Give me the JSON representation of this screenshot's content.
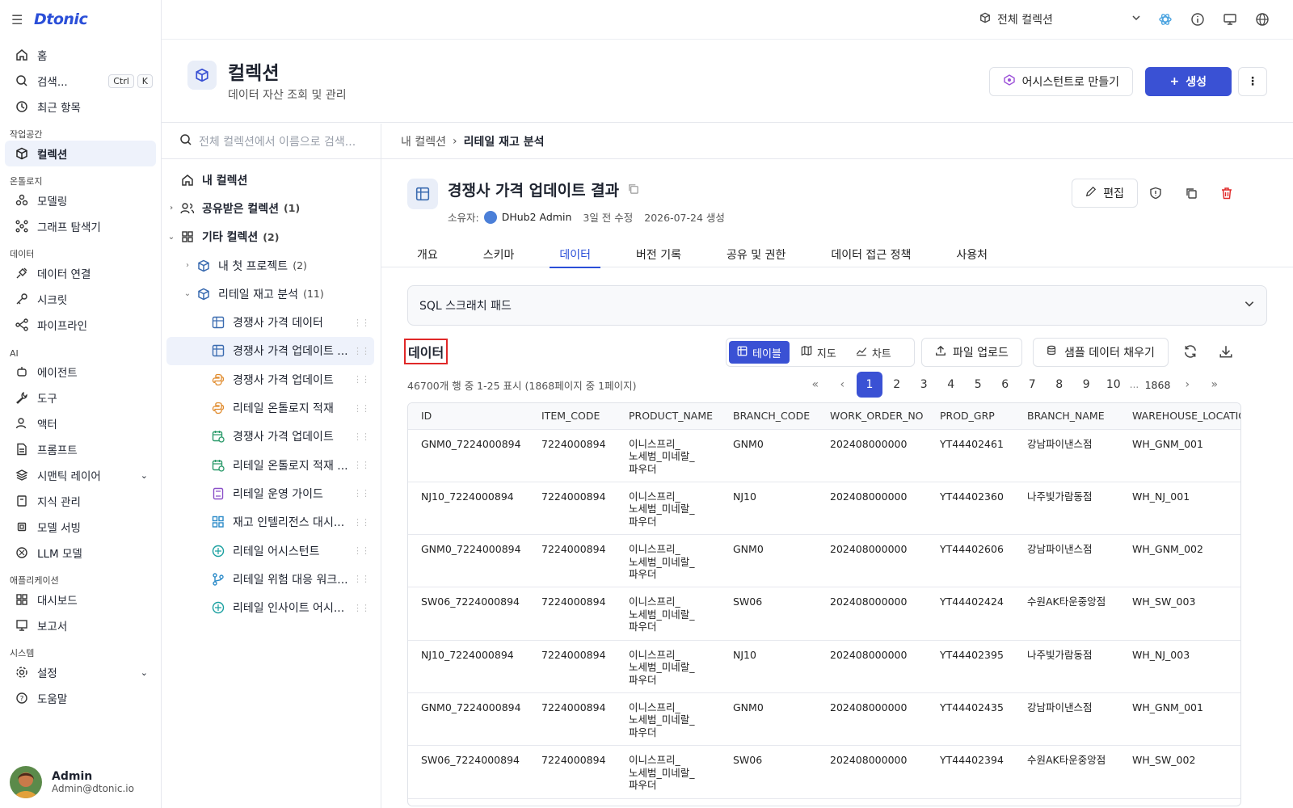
{
  "brand": {
    "name": "Dtonic"
  },
  "nav": {
    "home": "홈",
    "search": "검색...",
    "search_kbd": [
      "Ctrl",
      "K"
    ],
    "recent": "최근 항목",
    "sections": {
      "workspace": "작업공간",
      "ontology": "온톨로지",
      "data": "데이터",
      "ai": "AI",
      "apps": "애플리케이션",
      "system": "시스템"
    },
    "collection": "컬렉션",
    "modeling": "모델링",
    "graph": "그래프 탐색기",
    "connect": "데이터 연결",
    "secret": "시크릿",
    "pipeline": "파이프라인",
    "agent": "에이전트",
    "tool": "도구",
    "actor": "액터",
    "prompt": "프롬프트",
    "semantic": "시맨틱 레이어",
    "knowledge": "지식 관리",
    "serving": "모델 서빙",
    "llm": "LLM 모델",
    "dashboard": "대시보드",
    "report": "보고서",
    "settings": "설정",
    "help": "도움말"
  },
  "user": {
    "name": "Admin",
    "email": "Admin@dtonic.io"
  },
  "topbar": {
    "collection_select": "전체 컬렉션"
  },
  "header": {
    "title": "컬렉션",
    "subtitle": "데이터 자산 조회 및 관리",
    "assistant_btn": "어시스턴트로 만들기",
    "create_btn": "생성"
  },
  "tree": {
    "search_placeholder": "전체 컬렉션에서 이름으로 검색...",
    "my": "내 컬렉션",
    "shared": "공유받은 컬렉션",
    "shared_count": "(1)",
    "other": "기타 컬렉션",
    "other_count": "(2)",
    "proj": "내 첫 프로젝트",
    "proj_count": "(2)",
    "retail": "리테일 재고 분석",
    "retail_count": "(11)",
    "items": [
      "경쟁사 가격 데이터",
      "경쟁사 가격 업데이트 ...",
      "경쟁사 가격 업데이트",
      "리테일 온톨로지 적재",
      "경쟁사 가격 업데이트",
      "리테일 온톨로지 적재 ...",
      "리테일 운영 가이드",
      "재고 인텔리전스 대시...",
      "리테일 어시스턴트",
      "리테일 위험 대응 워크...",
      "리테일 인사이트 어시..."
    ]
  },
  "breadcrumb": {
    "root": "내 컬렉션",
    "current": "리테일 재고 분석"
  },
  "dataset": {
    "title": "경쟁사 가격 업데이트 결과",
    "owner_label": "소유자:",
    "owner": "DHub2 Admin",
    "modified": "3일 전 수정",
    "created": "2026-07-24 생성",
    "edit_btn": "편집"
  },
  "tabs": [
    "개요",
    "스키마",
    "데이터",
    "버전 기록",
    "공유 및 권한",
    "데이터 접근 정책",
    "사용처"
  ],
  "sql_pad": "SQL 스크래치 패드",
  "data_section": {
    "label": "데이터",
    "views": [
      "테이블",
      "지도",
      "차트"
    ],
    "upload": "파일 업로드",
    "sample": "샘플 데이터 채우기",
    "row_info": "46700개 행 중 1-25 표시 (1868페이지 중 1페이지)",
    "pages": [
      "1",
      "2",
      "3",
      "4",
      "5",
      "6",
      "7",
      "8",
      "9",
      "10",
      "...",
      "1868"
    ]
  },
  "table": {
    "columns": [
      "ID",
      "ITEM_CODE",
      "PRODUCT_NAME",
      "BRANCH_CODE",
      "WORK_ORDER_NO",
      "PROD_GRP",
      "BRANCH_NAME",
      "WAREHOUSE_LOCATION"
    ],
    "rows": [
      [
        "GNM0_7224000894",
        "7224000894",
        "이니스프리_\n노세범_미네랄_\n파우더",
        "GNM0",
        "202408000000",
        "YT44402461",
        "강남파이낸스점",
        "WH_GNM_001"
      ],
      [
        "NJ10_7224000894",
        "7224000894",
        "이니스프리_\n노세범_미네랄_\n파우더",
        "NJ10",
        "202408000000",
        "YT44402360",
        "나주빛가람동점",
        "WH_NJ_001"
      ],
      [
        "GNM0_7224000894",
        "7224000894",
        "이니스프리_\n노세범_미네랄_\n파우더",
        "GNM0",
        "202408000000",
        "YT44402606",
        "강남파이낸스점",
        "WH_GNM_002"
      ],
      [
        "SW06_7224000894",
        "7224000894",
        "이니스프리_\n노세범_미네랄_\n파우더",
        "SW06",
        "202408000000",
        "YT44402424",
        "수원AK타운중앙점",
        "WH_SW_003"
      ],
      [
        "NJ10_7224000894",
        "7224000894",
        "이니스프리_\n노세범_미네랄_\n파우더",
        "NJ10",
        "202408000000",
        "YT44402395",
        "나주빛가람동점",
        "WH_NJ_003"
      ],
      [
        "GNM0_7224000894",
        "7224000894",
        "이니스프리_\n노세범_미네랄_\n파우더",
        "GNM0",
        "202408000000",
        "YT44402435",
        "강남파이낸스점",
        "WH_GNM_001"
      ],
      [
        "SW06_7224000894",
        "7224000894",
        "이니스프리_\n노세범_미네랄_\n파우더",
        "SW06",
        "202408000000",
        "YT44402394",
        "수원AK타운중앙점",
        "WH_SW_002"
      ]
    ]
  },
  "colors": {
    "accent": "#3a51d4",
    "highlight": "#e02828",
    "brand": "#2b4fd8"
  }
}
